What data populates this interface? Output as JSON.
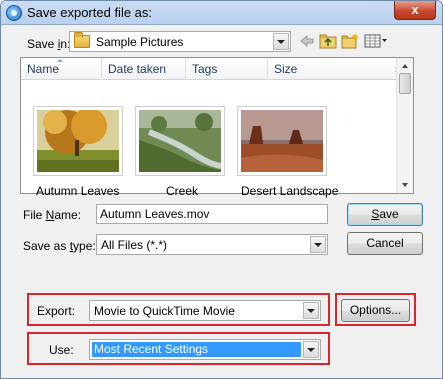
{
  "window": {
    "title": "Save exported file as:",
    "close_label": "x"
  },
  "save_in": {
    "label_pre": "Save ",
    "label_accel": "i",
    "label_post": "n:",
    "value": "Sample Pictures"
  },
  "toolbar": {
    "icons": [
      "back-arrow-icon",
      "up-folder-icon",
      "new-folder-icon",
      "view-menu-icon"
    ]
  },
  "file_list": {
    "columns": [
      "Name",
      "Date taken",
      "Tags",
      "Size"
    ],
    "more": "»",
    "items": [
      {
        "label": "Autumn Leaves"
      },
      {
        "label": "Creek"
      },
      {
        "label": "Desert Landscape"
      }
    ]
  },
  "file_name": {
    "label_accel": "N",
    "label_pre": "File ",
    "label_post": "ame:",
    "value": "Autumn Leaves.mov"
  },
  "save_as_type": {
    "label_pre": "Save as ",
    "label_accel": "t",
    "label_post": "ype:",
    "value": "All Files (*.*)"
  },
  "buttons": {
    "save_accel": "S",
    "save_rest": "ave",
    "cancel": "Cancel",
    "options": "Options..."
  },
  "export": {
    "label": "Export:",
    "value": "Movie to QuickTime Movie"
  },
  "use": {
    "label": "Use:",
    "value": "Most Recent Settings"
  },
  "colors": {
    "highlight_box": "#d9262b",
    "selection": "#3399ff"
  }
}
